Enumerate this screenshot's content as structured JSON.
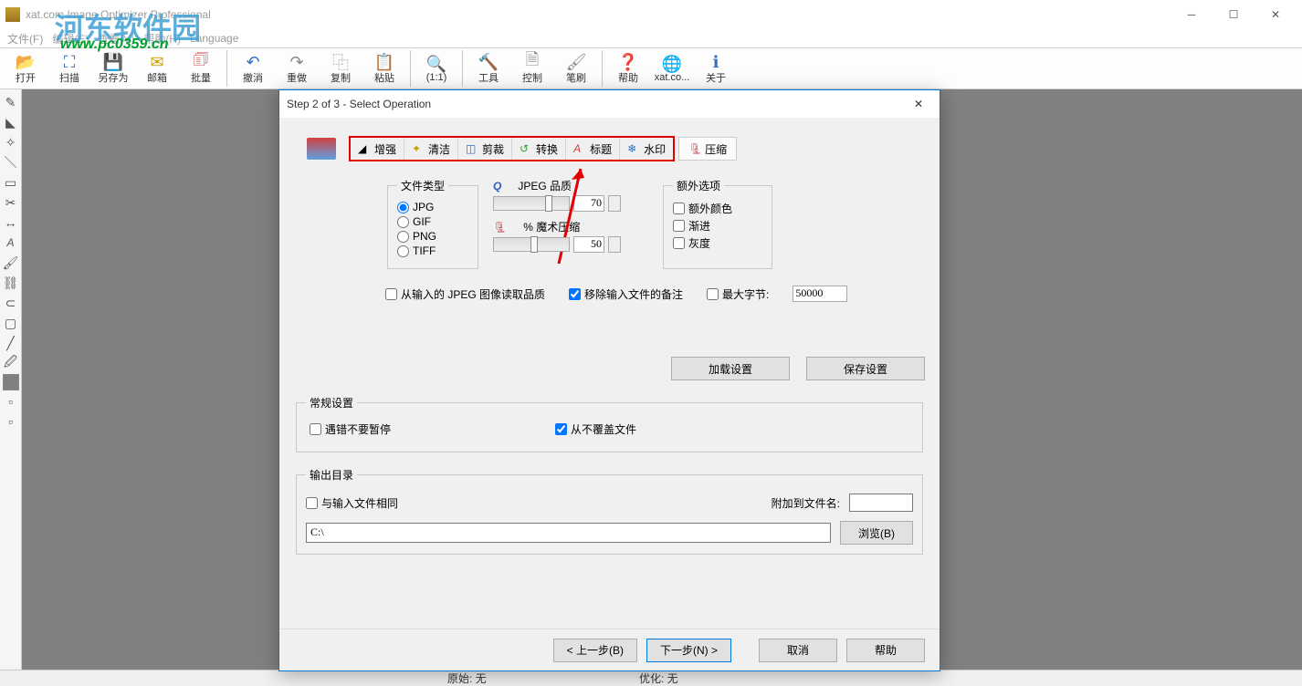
{
  "app": {
    "title": "xat.com  Image Optimizer Professional"
  },
  "watermark": {
    "text1": "河东软件园",
    "text2": "www.pc0359.cn"
  },
  "menu": {
    "file": "文件(F)",
    "edit": "编辑(E)",
    "view": "查看(V)",
    "help": "帮助(H)",
    "language": "Language"
  },
  "toolbar": {
    "open": "打开",
    "scan": "扫描",
    "saveas": "另存为",
    "mail": "邮箱",
    "batch": "批量",
    "undo": "撤消",
    "redo": "重做",
    "copy": "复制",
    "paste": "粘贴",
    "ratio": "(1:1)",
    "tools": "工具",
    "control": "控制",
    "brush": "笔刷",
    "helpbtn": "帮助",
    "xat": "xat.co...",
    "about": "关于"
  },
  "dialog": {
    "title": "Step 2 of 3 - Select Operation",
    "tabs": {
      "enhance": "增强",
      "clean": "清洁",
      "crop": "剪裁",
      "convert": "转换",
      "title": "标题",
      "watermark": "水印",
      "compress": "压缩"
    },
    "filetype": {
      "legend": "文件类型",
      "jpg": "JPG",
      "gif": "GIF",
      "png": "PNG",
      "tiff": "TIFF"
    },
    "quality": {
      "hdr1_prefix": "Q",
      "hdr1": "JPEG 品质",
      "val1": "70",
      "hdr2": "% 魔术压缩",
      "val2": "50"
    },
    "extra": {
      "legend": "额外选项",
      "extracolor": "额外颜色",
      "progressive": "渐进",
      "grayscale": "灰度"
    },
    "checks": {
      "readq": "从输入的 JPEG 图像读取品质",
      "removecomments": "移除输入文件的备注",
      "maxbytes": "最大字节:",
      "maxbytes_val": "50000"
    },
    "buttons": {
      "load": "加载设置",
      "save": "保存设置"
    },
    "general": {
      "legend": "常规设置",
      "dontpause": "遇错不要暂停",
      "nooverwrite": "从不覆盖文件"
    },
    "output": {
      "legend": "输出目录",
      "sameasinput": "与输入文件相同",
      "appendlabel": "附加到文件名:",
      "path": "C:\\",
      "browse": "浏览(B)"
    },
    "footer": {
      "back": "< 上一步(B)",
      "next": "下一步(N) >",
      "cancel": "取消",
      "help": "帮助"
    }
  },
  "status": {
    "orig": "原始: 无",
    "opt": "优化: 无"
  }
}
